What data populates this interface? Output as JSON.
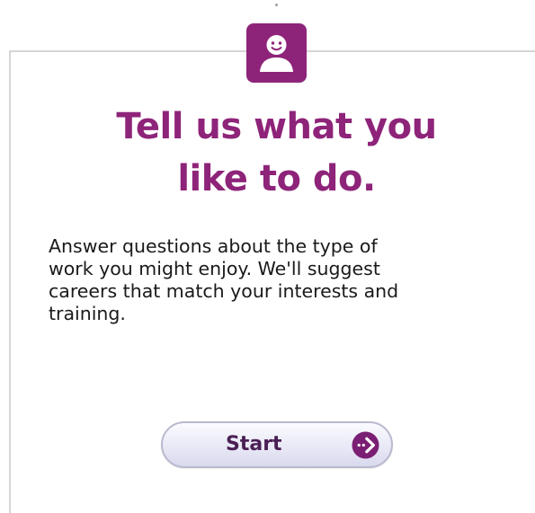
{
  "icons": {
    "avatar": "smiling-person-icon",
    "start_arrow": "arrow-right-circle-icon"
  },
  "colors": {
    "brand": "#8e2479",
    "button_text": "#4a1f55",
    "button_border": "#b9b9cf"
  },
  "headline": {
    "line1": "Tell us what you",
    "line2": "like to do."
  },
  "description": {
    "line1": "Answer questions about the type of",
    "line2": "work you might enjoy. We'll suggest",
    "line3": "careers that match your interests and",
    "line4": "training."
  },
  "start_button": {
    "label": "Start"
  }
}
